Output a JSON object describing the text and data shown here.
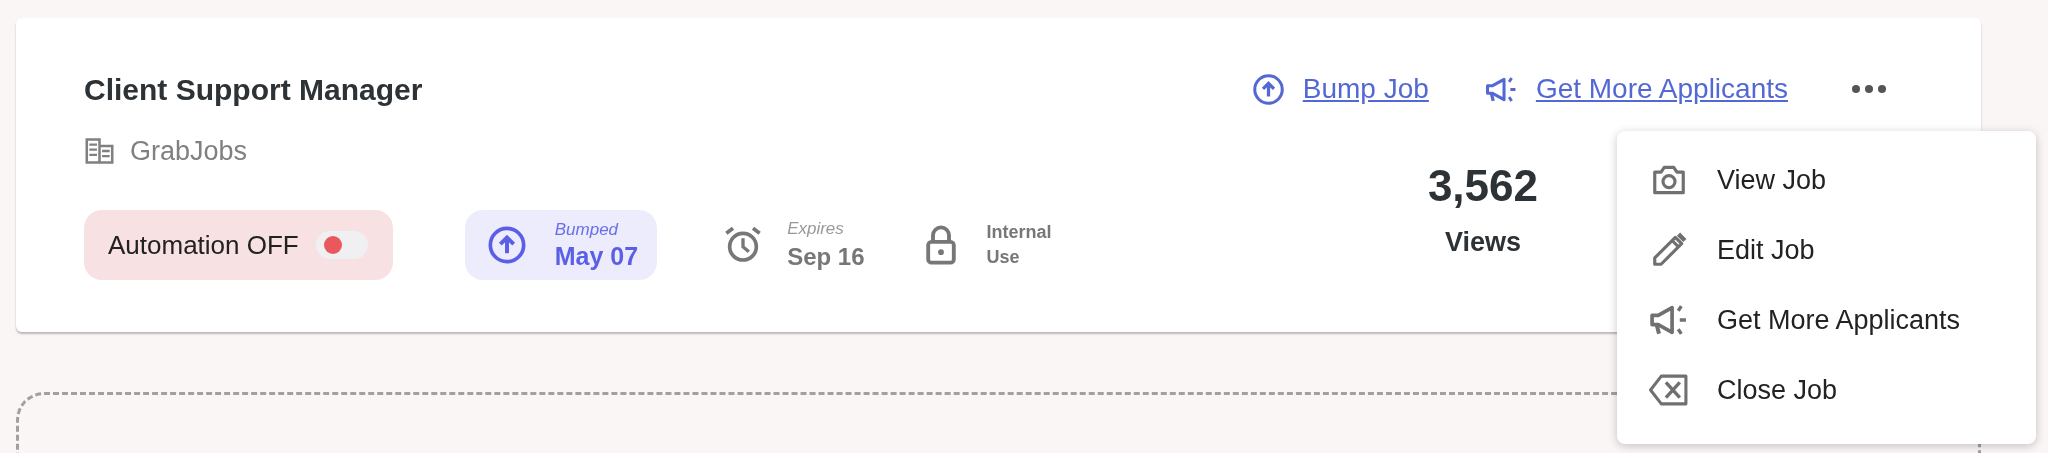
{
  "job": {
    "title": "Client Support Manager",
    "company": "GrabJobs"
  },
  "actions": [
    {
      "kind": "bump",
      "label": "Bump Job"
    },
    {
      "kind": "megaphone",
      "label": "Get More Applicants"
    }
  ],
  "automation": {
    "label": "Automation OFF",
    "on": false
  },
  "bumped": {
    "label": "Bumped",
    "date": "May 07"
  },
  "meta": [
    {
      "kind": "alarm",
      "label": "Expires",
      "value": "Sep 16"
    },
    {
      "kind": "lock",
      "value": "Internal Use"
    }
  ],
  "views": {
    "count": "3,562",
    "label": "Views"
  },
  "menu": [
    {
      "kind": "camera",
      "label": "View Job"
    },
    {
      "kind": "pencil",
      "label": "Edit Job"
    },
    {
      "kind": "megaphone",
      "label": "Get More Applicants"
    },
    {
      "kind": "close",
      "label": "Close Job"
    }
  ]
}
